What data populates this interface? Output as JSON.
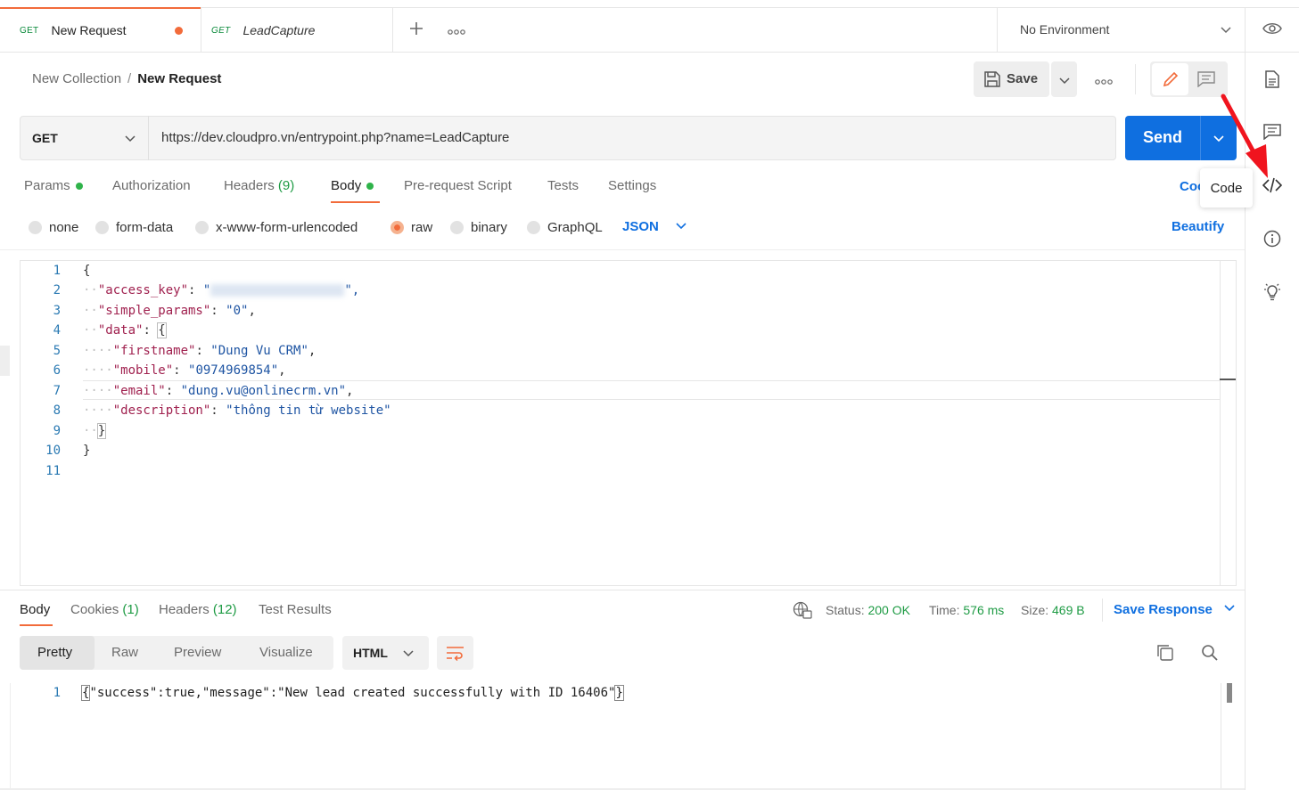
{
  "tabs": [
    {
      "method": "GET",
      "title": "New Request"
    },
    {
      "method": "GET",
      "title": "LeadCapture"
    }
  ],
  "environment": "No Environment",
  "breadcrumb": {
    "collection": "New Collection",
    "separator": "/",
    "request": "New Request"
  },
  "toolbar": {
    "save_label": "Save"
  },
  "request": {
    "method": "GET",
    "url": "https://dev.cloudpro.vn/entrypoint.php?name=LeadCapture",
    "send_label": "Send"
  },
  "request_tabs": {
    "params": "Params",
    "authorization": "Authorization",
    "headers": "Headers",
    "headers_count": "(9)",
    "body": "Body",
    "pre_request": "Pre-request Script",
    "tests": "Tests",
    "settings": "Settings",
    "cookies_link": "Coo"
  },
  "tooltip": "Code",
  "body_modes": [
    "none",
    "form-data",
    "x-www-form-urlencoded",
    "raw",
    "binary",
    "GraphQL"
  ],
  "body_format": "JSON",
  "beautify": "Beautify",
  "editor": {
    "line_numbers": [
      "1",
      "2",
      "3",
      "4",
      "5",
      "6",
      "7",
      "8",
      "9",
      "10",
      "11"
    ],
    "lines": [
      [
        "{"
      ],
      [
        "\"access_key\"",
        ": ",
        "\"",
        "\","
      ],
      [
        "\"simple_params\"",
        ": ",
        "\"0\"",
        ","
      ],
      [
        "\"data\"",
        ": ",
        "{"
      ],
      [
        "\"firstname\"",
        ": ",
        "\"Dung Vu CRM\"",
        ","
      ],
      [
        "\"mobile\"",
        ": ",
        "\"0974969854\"",
        ","
      ],
      [
        "\"email\"",
        ": ",
        "\"dung.vu@onlinecrm.vn\"",
        ","
      ],
      [
        "\"description\"",
        ": ",
        "\"thông tin từ website\""
      ],
      [
        "}"
      ],
      [
        "}"
      ],
      [
        ""
      ]
    ]
  },
  "response_tabs": {
    "body": "Body",
    "cookies": "Cookies",
    "cookies_count": "(1)",
    "headers": "Headers",
    "headers_count": "(12)",
    "test_results": "Test Results"
  },
  "response_status": {
    "status_label": "Status:",
    "status_value": "200 OK",
    "time_label": "Time:",
    "time_value": "576 ms",
    "size_label": "Size:",
    "size_value": "469 B",
    "save_response": "Save Response"
  },
  "view_modes": [
    "Pretty",
    "Raw",
    "Preview",
    "Visualize"
  ],
  "response_format": "HTML",
  "response_body": {
    "line_number": "1",
    "text": "\"success\":true,\"message\":\"New lead created successfully with ID 16406\""
  },
  "colors": {
    "accent_orange": "#f26b3a",
    "send_blue": "#0f6fe0",
    "status_green": "#1e9b44"
  }
}
